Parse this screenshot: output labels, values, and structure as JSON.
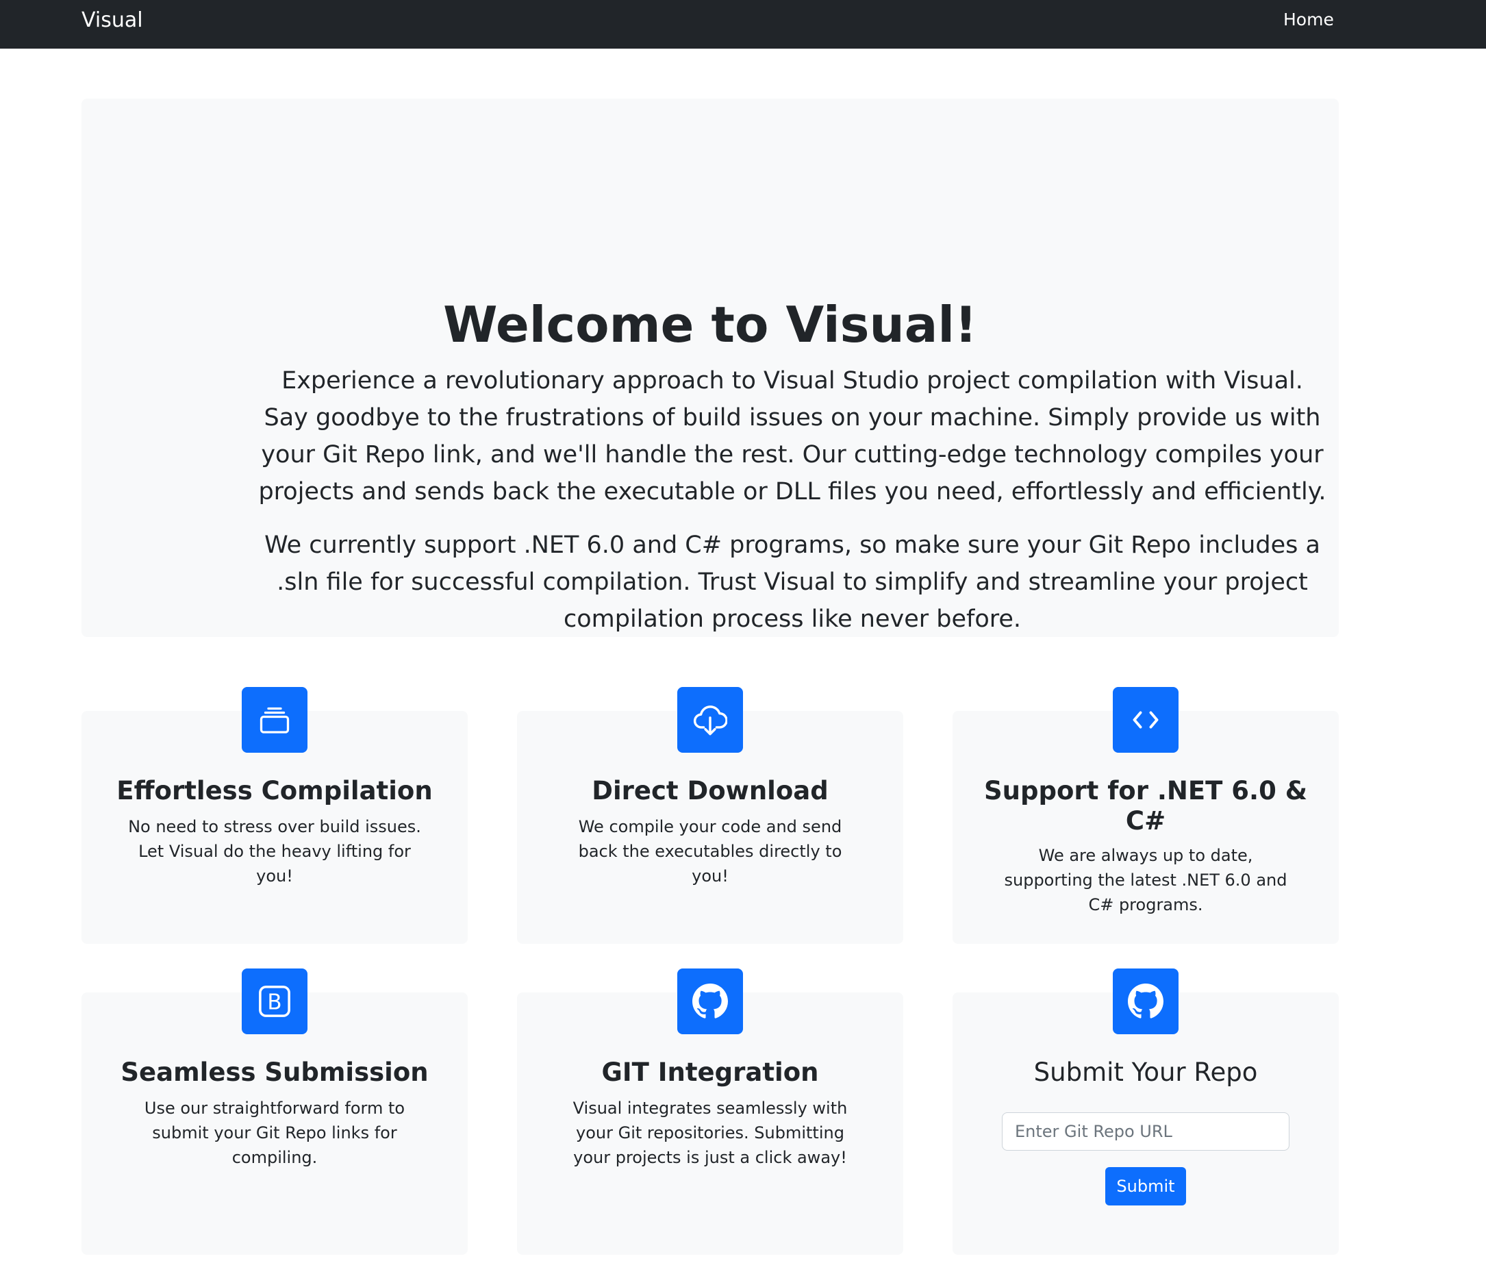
{
  "navbar": {
    "brand": "Visual",
    "links": [
      {
        "label": "Home"
      }
    ]
  },
  "hero": {
    "title": "Welcome to Visual!",
    "paragraphs": [
      "Experience a revolutionary approach to Visual Studio project compilation with Visual. Say goodbye to the frustrations of build issues on your machine. Simply provide us with your Git Repo link, and we'll handle the rest. Our cutting-edge technology compiles your projects and sends back the executable or DLL files you need, effortlessly and efficiently.",
      "We currently support .NET 6.0 and C# programs, so make sure your Git Repo includes a .sln file for successful compilation. Trust Visual to simplify and streamline your project compilation process like never before."
    ]
  },
  "features": [
    {
      "icon": "collection-icon",
      "title": "Effortless Compilation",
      "text": "No need to stress over build issues. Let Visual do the heavy lifting for you!"
    },
    {
      "icon": "cloud-download-icon",
      "title": "Direct Download",
      "text": "We compile your code and send back the executables directly to you!"
    },
    {
      "icon": "code-icon",
      "title": "Support for .NET 6.0 & C#",
      "text": "We are always up to date, supporting the latest .NET 6.0 and C# programs."
    },
    {
      "icon": "bootstrap-icon",
      "title": "Seamless Submission",
      "text": "Use our straightforward form to submit your Git Repo links for compiling."
    },
    {
      "icon": "github-icon",
      "title": "GIT Integration",
      "text": "Visual integrates seamlessly with your Git repositories. Submitting your projects is just a click away!"
    }
  ],
  "submit_card": {
    "icon": "github-icon",
    "title": "Submit Your Repo",
    "input_value": "",
    "input_placeholder": "Enter Git Repo URL",
    "button_label": "Submit"
  },
  "colors": {
    "navbar_bg": "#212529",
    "accent": "#0d6efd",
    "card_bg": "#f8f9fa",
    "text": "#212529"
  }
}
